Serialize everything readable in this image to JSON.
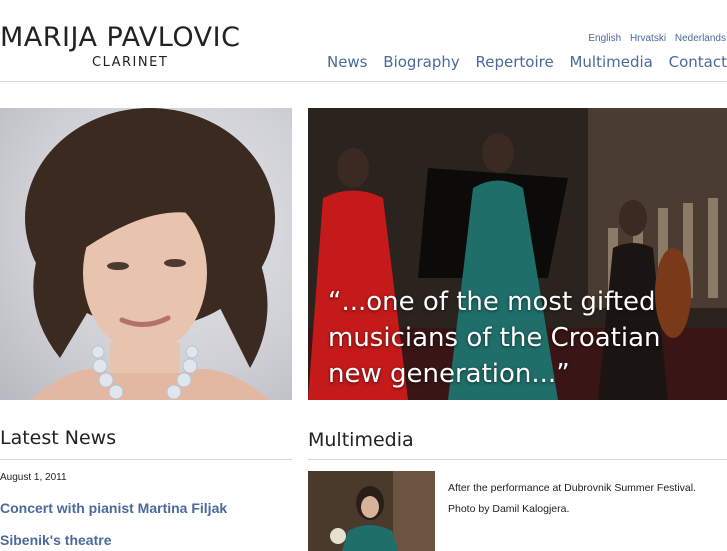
{
  "brand": {
    "name": "MARIJA PAVLOVIC",
    "subtitle": "CLARINET"
  },
  "languages": [
    "English",
    "Hrvatski",
    "Nederlands"
  ],
  "nav": [
    "News",
    "Biography",
    "Repertoire",
    "Multimedia",
    "Contact"
  ],
  "hero": {
    "quote_lines": [
      "“...one of the most gifted",
      "musicians of the Croatian",
      "new generation...”"
    ]
  },
  "latest_news": {
    "heading": "Latest News",
    "date": "August 1, 2011",
    "items": [
      "Concert with pianist Martina Filjak",
      "Sibenik's theatre"
    ]
  },
  "multimedia": {
    "heading": "Multimedia",
    "caption": "After the performance at Dubrovnik Summer Festival.",
    "credit": "Photo by Damil Kalogjera."
  },
  "colors": {
    "link": "#4a6a9a",
    "rule": "#d8d8d8",
    "text": "#222222"
  }
}
